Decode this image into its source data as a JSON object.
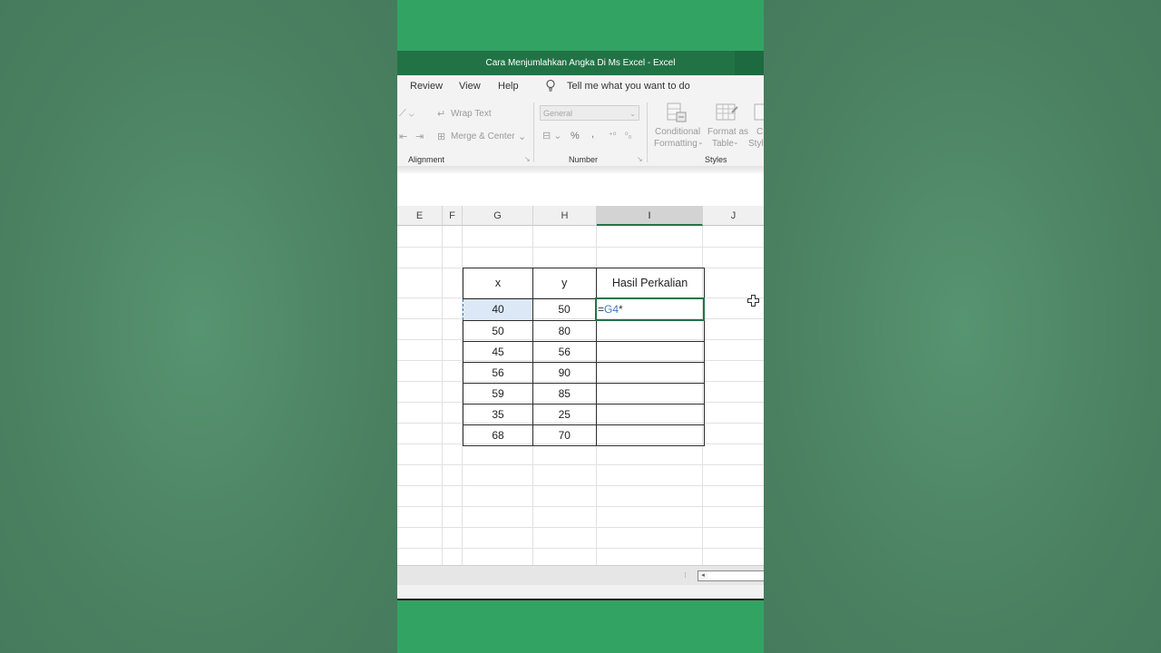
{
  "window": {
    "title": "Cara Menjumlahkan Angka Di Ms Excel  -  Excel"
  },
  "menu": {
    "items": [
      "Review",
      "View",
      "Help"
    ],
    "tell_me": "Tell me what you want to do"
  },
  "ribbon": {
    "wrap_text": "Wrap Text",
    "merge_center": "Merge & Center",
    "number_format": "General",
    "percent": "%",
    "comma": ",",
    "conditional_formatting": [
      "Conditional",
      "Formatting"
    ],
    "format_as_table": [
      "Format as",
      "Table"
    ],
    "cell_styles": [
      "C",
      "Style"
    ],
    "groups": {
      "alignment": "Alignment",
      "number": "Number",
      "styles": "Styles"
    }
  },
  "columns": [
    "E",
    "F",
    "G",
    "H",
    "I",
    "J"
  ],
  "active_column": "I",
  "table": {
    "headers": [
      "x",
      "y",
      "Hasil Perkalian"
    ],
    "rows": [
      [
        "40",
        "50"
      ],
      [
        "50",
        "80"
      ],
      [
        "45",
        "56"
      ],
      [
        "56",
        "90"
      ],
      [
        "59",
        "85"
      ],
      [
        "35",
        "25"
      ],
      [
        "68",
        "70"
      ]
    ]
  },
  "editing_cell": {
    "eq": "=",
    "ref": "G4",
    "op": "*"
  },
  "colors": {
    "excel_green": "#217346",
    "reference_blue": "#3d78c4",
    "background_green": "#33a364"
  }
}
